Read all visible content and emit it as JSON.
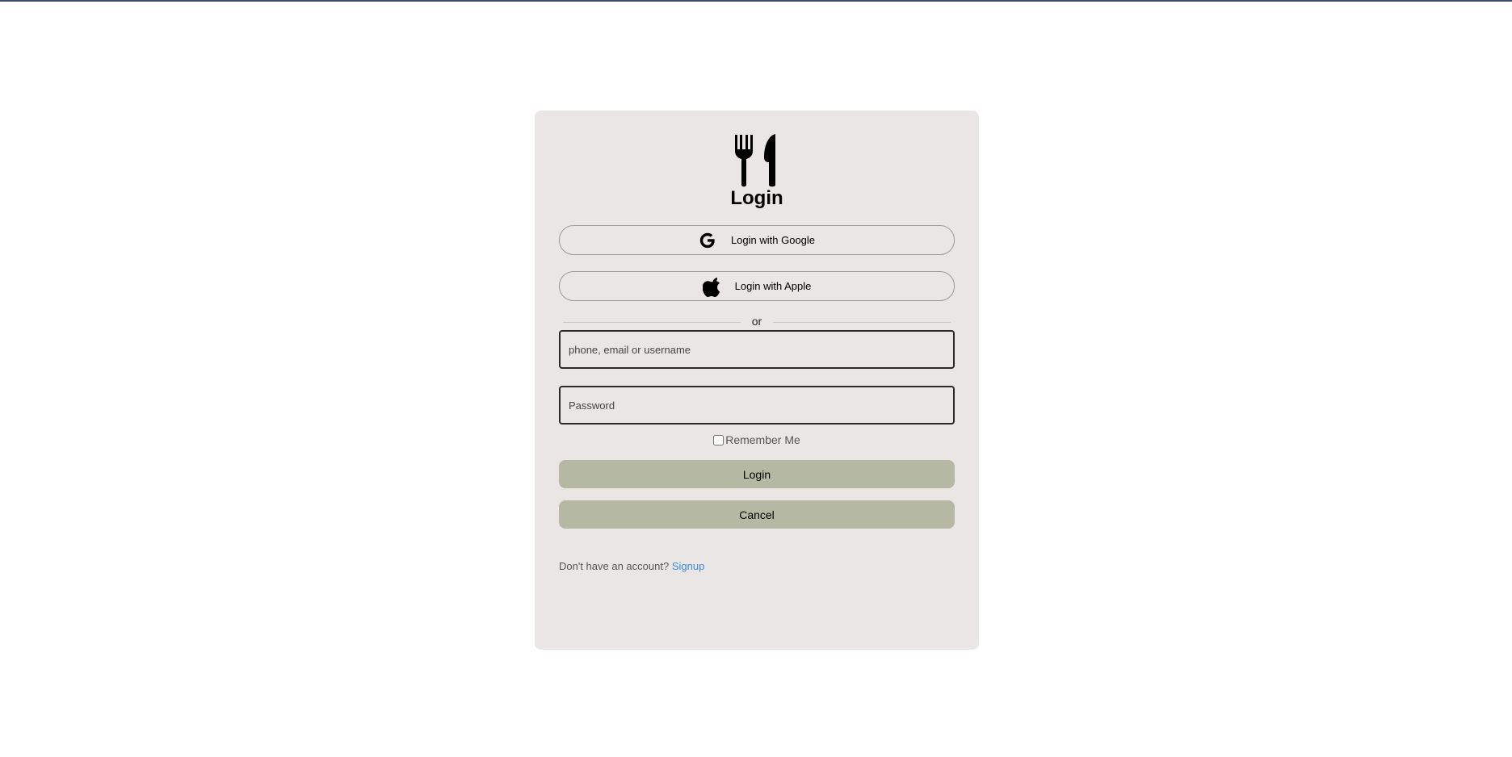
{
  "title": "Login",
  "social": {
    "google_label": "Login with Google",
    "apple_label": "Login with Apple"
  },
  "divider_text": "or",
  "fields": {
    "user_placeholder": "phone, email or username",
    "password_placeholder": "Password"
  },
  "remember_label": "Remember Me",
  "buttons": {
    "login": "Login",
    "cancel": "Cancel"
  },
  "signup": {
    "prompt": "Don't have an account?",
    "link": "Signup"
  },
  "icons": {
    "logo": "fork-knife-icon",
    "google": "google-icon",
    "apple": "apple-icon"
  },
  "colors": {
    "card_bg": "#e9e6e5",
    "button_bg": "#b5b8a3",
    "link": "#3b8ad6"
  }
}
